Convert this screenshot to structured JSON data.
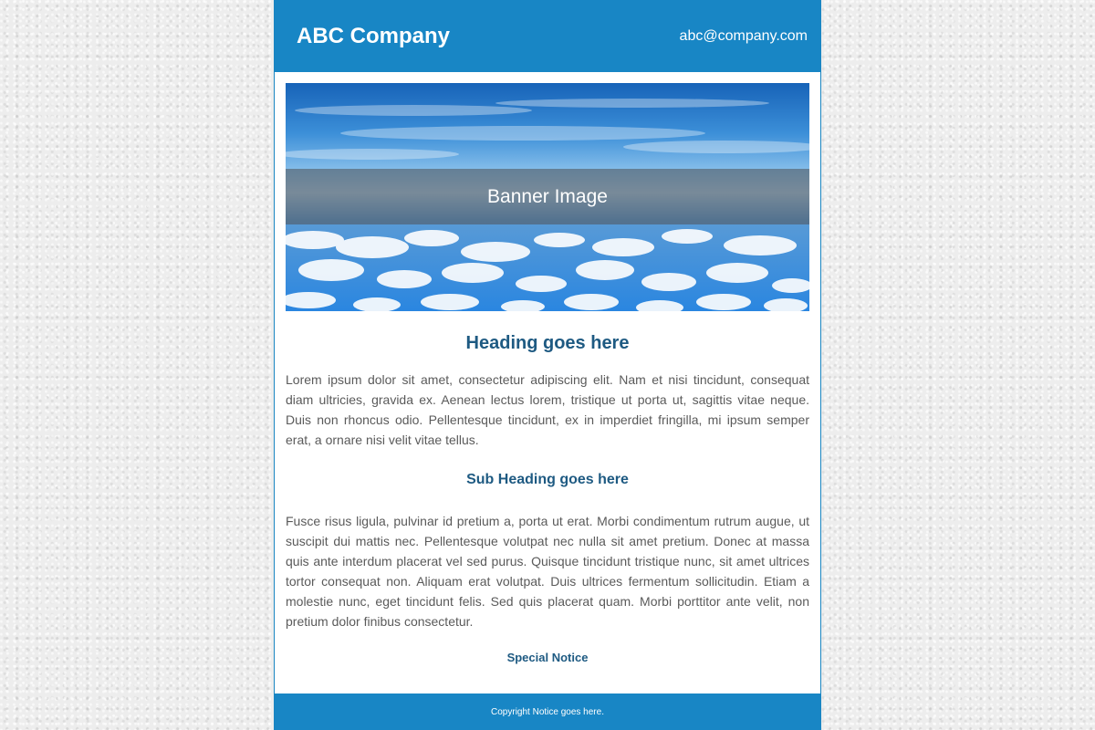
{
  "header": {
    "company_name": "ABC Company",
    "email": "abc@company.com"
  },
  "banner": {
    "label": "Banner Image"
  },
  "main": {
    "heading": "Heading goes here",
    "paragraph_1": "Lorem ipsum dolor sit amet, consectetur adipiscing elit. Nam et nisi tincidunt, consequat diam ultricies, gravida ex. Aenean lectus lorem, tristique ut porta ut, sagittis vitae neque. Duis non rhoncus odio. Pellentesque tincidunt, ex in imperdiet fringilla, mi ipsum semper erat, a ornare nisi velit vitae tellus.",
    "sub_heading": "Sub Heading goes here",
    "paragraph_2": "Fusce risus ligula, pulvinar id pretium a, porta ut erat. Morbi condimentum rutrum augue, ut suscipit dui mattis nec. Pellentesque volutpat nec nulla sit amet pretium. Donec at massa quis ante interdum placerat vel sed purus. Quisque tincidunt tristique nunc, sit amet ultrices tortor consequat non. Aliquam erat volutpat. Duis ultrices fermentum sollicitudin. Etiam a molestie nunc, eget tincidunt felis. Sed quis placerat quam. Morbi porttitor ante velit, non pretium dolor finibus consectetur.",
    "special_notice": "Special Notice"
  },
  "footer": {
    "copyright": "Copyright Notice goes here."
  },
  "colors": {
    "brand": "#1886c5",
    "heading": "#1e5a82",
    "body_text": "#5a5a5a"
  }
}
